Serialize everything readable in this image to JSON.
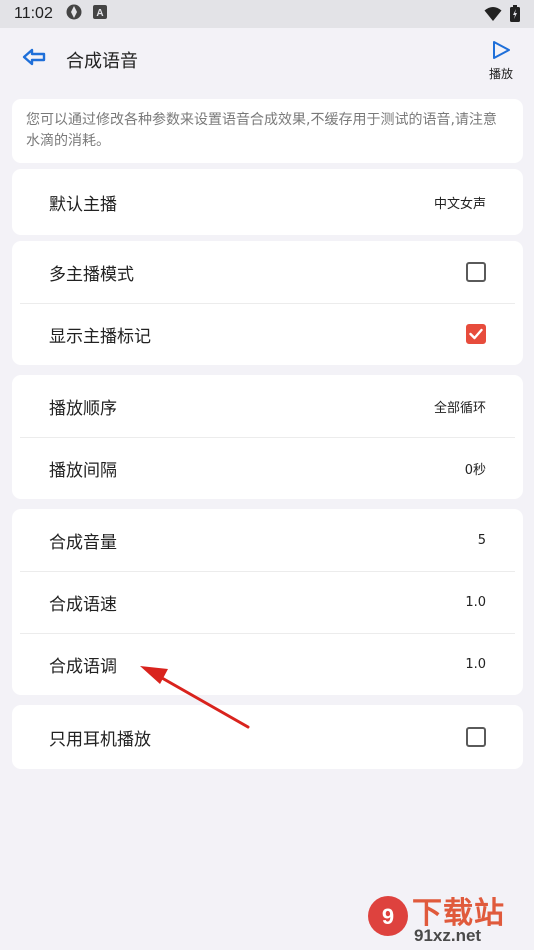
{
  "status": {
    "time": "11:02"
  },
  "appbar": {
    "title": "合成语音",
    "play_label": "播放"
  },
  "description": "您可以通过修改各种参数来设置语音合成效果,不缓存用于测试的语音,请注意水滴的消耗。",
  "groups": [
    {
      "rows": [
        {
          "label": "默认主播",
          "value": "中文女声"
        }
      ]
    },
    {
      "rows": [
        {
          "label": "多主播模式",
          "checked": false
        },
        {
          "label": "显示主播标记",
          "checked": true
        }
      ]
    },
    {
      "rows": [
        {
          "label": "播放顺序",
          "value": "全部循环"
        },
        {
          "label": "播放间隔",
          "value": "0秒"
        }
      ]
    },
    {
      "rows": [
        {
          "label": "合成音量",
          "value": "5"
        },
        {
          "label": "合成语速",
          "value": "1.0"
        },
        {
          "label": "合成语调",
          "value": "1.0"
        }
      ]
    },
    {
      "rows": [
        {
          "label": "只用耳机播放",
          "checked": false
        }
      ]
    }
  ],
  "watermark": {
    "brand": "下载站",
    "domain": "91xz.net"
  },
  "colors": {
    "accent": "#1e6fd9",
    "check": "#e74c3c",
    "arrow": "#d9231d"
  }
}
